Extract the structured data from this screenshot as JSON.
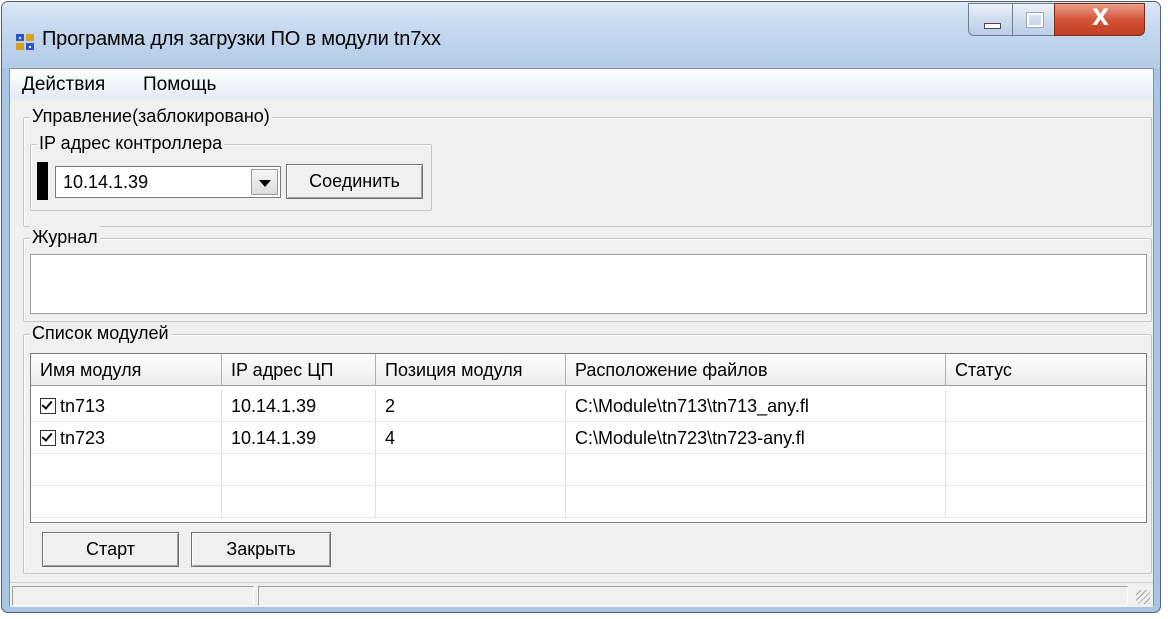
{
  "window": {
    "title": "Программа для загрузки ПО в модули tn7xx",
    "close_glyph": "X"
  },
  "menu": {
    "actions": "Действия",
    "help": "Помощь"
  },
  "control_group": {
    "label": "Управление(заблокировано)",
    "ip_group_label": "IP адрес контроллера",
    "ip_value": "10.14.1.39",
    "connect_button": "Соединить"
  },
  "journal": {
    "label": "Журнал"
  },
  "modules": {
    "label": "Список модулей",
    "columns": [
      "Имя модуля",
      "IP адрес ЦП",
      "Позиция модуля",
      "Расположение файлов",
      "Статус"
    ],
    "rows": [
      {
        "checked": true,
        "name": "tn713",
        "ip": "10.14.1.39",
        "position": "2",
        "path": "C:\\Module\\tn713\\tn713_any.fl",
        "status": ""
      },
      {
        "checked": true,
        "name": "tn723",
        "ip": "10.14.1.39",
        "position": "4",
        "path": "C:\\Module\\tn723\\tn723-any.fl",
        "status": ""
      }
    ]
  },
  "buttons": {
    "start": "Старт",
    "close": "Закрыть"
  }
}
